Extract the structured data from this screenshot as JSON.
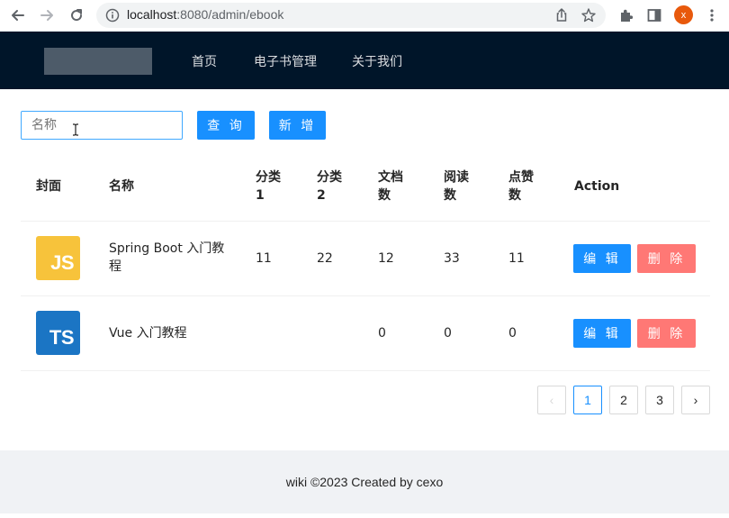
{
  "browser": {
    "url_host": "localhost",
    "url_path": ":8080/admin/ebook",
    "avatar_letter": "x"
  },
  "header": {
    "menu": [
      {
        "label": "首页"
      },
      {
        "label": "电子书管理"
      },
      {
        "label": "关于我们"
      }
    ]
  },
  "toolbar": {
    "search_placeholder": "名称",
    "query_label": "查 询",
    "add_label": "新 增"
  },
  "table": {
    "columns": {
      "cover": "封面",
      "name": "名称",
      "category1": [
        "分类",
        "1"
      ],
      "category2": [
        "分类",
        "2"
      ],
      "doc_count": [
        "文档",
        "数"
      ],
      "view_count": [
        "阅读",
        "数"
      ],
      "vote_count": [
        "点赞",
        "数"
      ],
      "action": "Action"
    },
    "rows": [
      {
        "cover_text": "JS",
        "name_lines": [
          "Spring Boot 入门教",
          "程"
        ],
        "category1": "11",
        "category2": "22",
        "doc_count": "12",
        "view_count": "33",
        "vote_count": "11",
        "edit_label": "编 辑",
        "delete_label": "删 除"
      },
      {
        "cover_text": "TS",
        "name_lines": [
          "Vue 入门教程"
        ],
        "category1": "",
        "category2": "",
        "doc_count": "0",
        "view_count": "0",
        "vote_count": "0",
        "edit_label": "编 辑",
        "delete_label": "删 除"
      }
    ]
  },
  "pagination": {
    "prev": "‹",
    "pages": [
      "1",
      "2",
      "3"
    ],
    "next": "›",
    "current": "1"
  },
  "footer": {
    "text": "wiki ©2023 Created by cexo"
  },
  "colors": {
    "header_bg": "#001529",
    "primary": "#1890ff",
    "danger": "#ff7875",
    "js_cover": "#f7c33b",
    "ts_cover": "#1b75c4"
  },
  "icons": {
    "back": "back-arrow-icon",
    "forward": "forward-arrow-icon",
    "reload": "reload-icon",
    "info": "info-icon",
    "share": "share-icon",
    "bookmark": "star-icon",
    "extensions": "puzzle-icon",
    "sidebar": "side-panel-icon",
    "menu": "kebab-menu-icon"
  }
}
